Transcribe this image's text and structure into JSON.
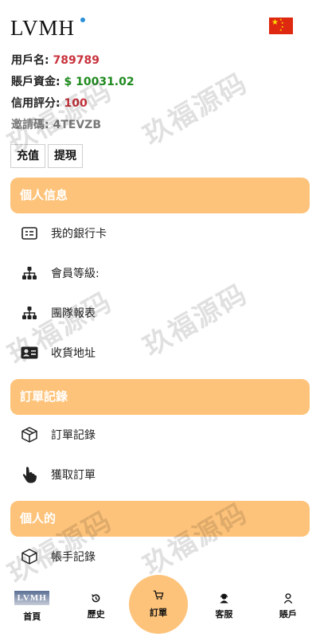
{
  "header": {
    "logo": "LVMH",
    "flag_icon": "china-flag-icon"
  },
  "account": {
    "username_label": "用戶名:",
    "username_value": "789789",
    "balance_label": "賬戶資金:",
    "balance_value": "$ 10031.02",
    "credit_label": "信用評分:",
    "credit_value": "100",
    "invite_label": "邀請碼:",
    "invite_value": "4TEVZB"
  },
  "actions": {
    "recharge": "充值",
    "withdraw": "提現"
  },
  "sections": [
    {
      "title": "個人信息",
      "items": [
        {
          "label": "我的銀行卡",
          "icon": "bank-card-icon"
        },
        {
          "label": "會員等級:",
          "icon": "hierarchy-icon"
        },
        {
          "label": "團隊報表",
          "icon": "hierarchy-icon"
        },
        {
          "label": "收貨地址",
          "icon": "id-card-icon"
        }
      ]
    },
    {
      "title": "訂單記錄",
      "items": [
        {
          "label": "訂單記錄",
          "icon": "box-icon"
        },
        {
          "label": "獲取訂單",
          "icon": "pointer-hand-icon"
        }
      ]
    },
    {
      "title": "個人的",
      "items": [
        {
          "label": "帳手記錄",
          "icon": "box-icon"
        }
      ]
    }
  ],
  "watermark": "玖福源码",
  "nav": {
    "home": "首頁",
    "home_logo": "LVMH",
    "history": "歷史",
    "order": "訂單",
    "service": "客服",
    "account": "賬戶"
  },
  "colors": {
    "accent": "#fec37a",
    "username": "#c8323c",
    "balance": "#1f8a1f",
    "invite": "#7a7a7a",
    "flag": "#de2910"
  }
}
